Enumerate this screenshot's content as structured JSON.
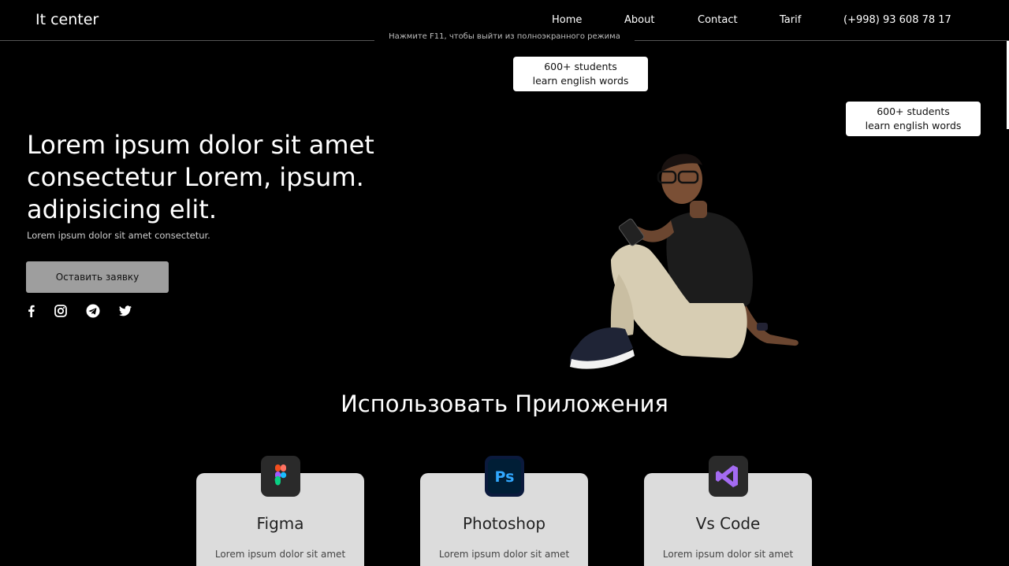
{
  "header": {
    "logo": "It center",
    "nav": [
      {
        "label": "Home"
      },
      {
        "label": "About"
      },
      {
        "label": "Contact"
      },
      {
        "label": "Tarif"
      },
      {
        "label": "(+998) 93 608 78 17"
      }
    ],
    "fullscreen_hint": "Нажмите F11, чтобы выйти из полноэкранного режима"
  },
  "stat_cards": [
    {
      "line1": "600+ students",
      "line2": "learn english words"
    },
    {
      "line1": "600+ students",
      "line2": "learn english words"
    }
  ],
  "hero": {
    "title": "Lorem ipsum dolor sit amet consectetur Lorem, ipsum. adipisicing elit.",
    "subtitle": "Lorem ipsum dolor sit amet consectetur.",
    "cta_label": "Оставить заявку",
    "socials": [
      "facebook-icon",
      "instagram-icon",
      "telegram-icon",
      "twitter-icon"
    ]
  },
  "apps_section": {
    "title": "Использовать Приложения",
    "cards": [
      {
        "name": "Figma",
        "desc": "Lorem ipsum dolor sit amet",
        "icon": "figma-icon"
      },
      {
        "name": "Photoshop",
        "desc": "Lorem ipsum dolor sit amet",
        "icon": "photoshop-icon"
      },
      {
        "name": "Vs Code",
        "desc": "Lorem ipsum dolor sit amet",
        "icon": "vscode-icon"
      }
    ]
  },
  "colors": {
    "background": "#000000",
    "cta": "#9e9e9e",
    "card": "#dcdcdc",
    "photoshop_blue": "#31a8ff",
    "vscode_purple": "#a46bf2"
  }
}
